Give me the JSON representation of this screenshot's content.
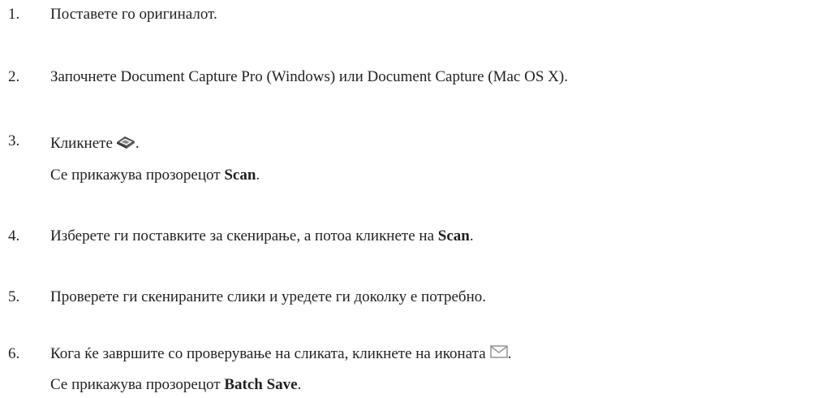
{
  "steps": [
    {
      "number": "1.",
      "text": "Поставете го оригиналот."
    },
    {
      "number": "2.",
      "text": "Започнете Document Capture Pro (Windows) или Document Capture (Mac OS X)."
    },
    {
      "number": "3.",
      "text_before": "Кликнете",
      "text_after": ".",
      "icon": "scanner-icon",
      "note_prefix": "Се прикажува прозорецот ",
      "note_bold": "Scan",
      "note_suffix": "."
    },
    {
      "number": "4.",
      "text_prefix": "Изберете ги поставките за скенирање, а потоа кликнете на ",
      "text_bold": "Scan",
      "text_suffix": "."
    },
    {
      "number": "5.",
      "text": "Проверете ги скенираните слики и уредете ги доколку е потребно."
    },
    {
      "number": "6.",
      "text_before": "Кога ќе завршите со проверување на сликата, кликнете на иконата",
      "text_after": ".",
      "icon": "email-icon",
      "note_prefix": "Се прикажува прозорецот ",
      "note_bold": "Batch Save",
      "note_suffix": "."
    }
  ]
}
